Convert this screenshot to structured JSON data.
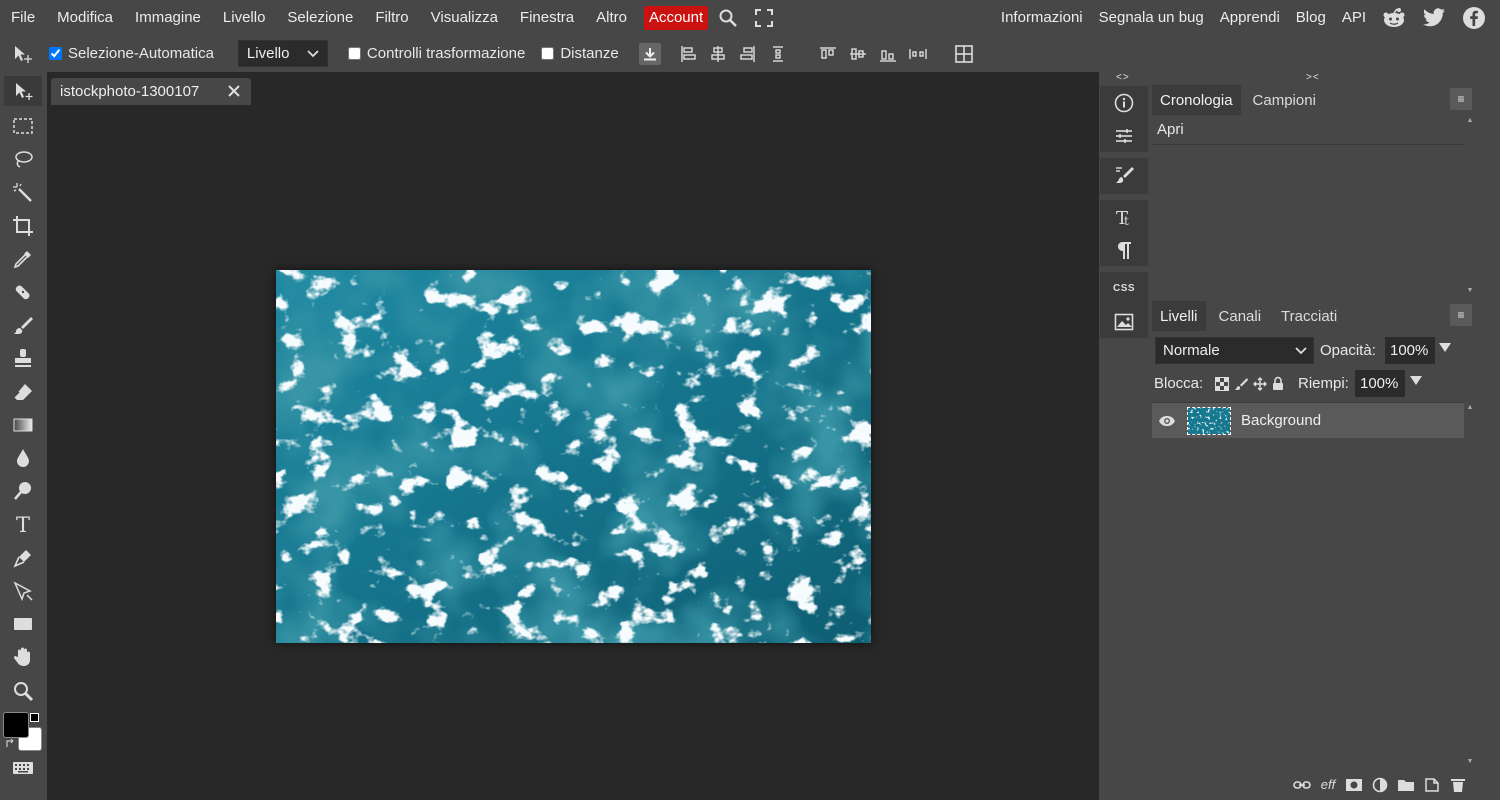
{
  "menubar": {
    "left_items": [
      "File",
      "Modifica",
      "Immagine",
      "Livello",
      "Selezione",
      "Filtro",
      "Visualizza",
      "Finestra",
      "Altro"
    ],
    "account_label": "Account",
    "right_items": [
      "Informazioni",
      "Segnala un bug",
      "Apprendi",
      "Blog",
      "API"
    ],
    "icons": [
      "search-icon",
      "fullscreen-icon",
      "reddit-icon",
      "twitter-icon",
      "facebook-icon"
    ],
    "account_color": "#cc1111"
  },
  "options_bar": {
    "auto_select_label": "Selezione-Automatica",
    "auto_select_checked": true,
    "target_select_value": "Livello",
    "transform_controls_label": "Controlli trasformazione",
    "distances_label": "Distanze"
  },
  "document": {
    "tab_name": "istockphoto-1300107",
    "image_description_colors": [
      "#1a7f96",
      "#0f5f73",
      "#e6f4f8"
    ]
  },
  "history_panel": {
    "tabs": [
      "Cronologia",
      "Campioni"
    ],
    "active_tab": "Cronologia",
    "entries": [
      "Apri"
    ]
  },
  "layers_panel": {
    "tabs": [
      "Livelli",
      "Canali",
      "Tracciati"
    ],
    "active_tab": "Livelli",
    "blend_mode": "Normale",
    "opacity_label": "Opacità:",
    "opacity_value": "100%",
    "lock_label": "Blocca:",
    "fill_label": "Riempi:",
    "fill_value": "100%",
    "layers": [
      {
        "name": "Background",
        "visible": true
      }
    ],
    "footer_fx_label": "eff"
  },
  "side_icons": {
    "css_label": "CSS"
  }
}
